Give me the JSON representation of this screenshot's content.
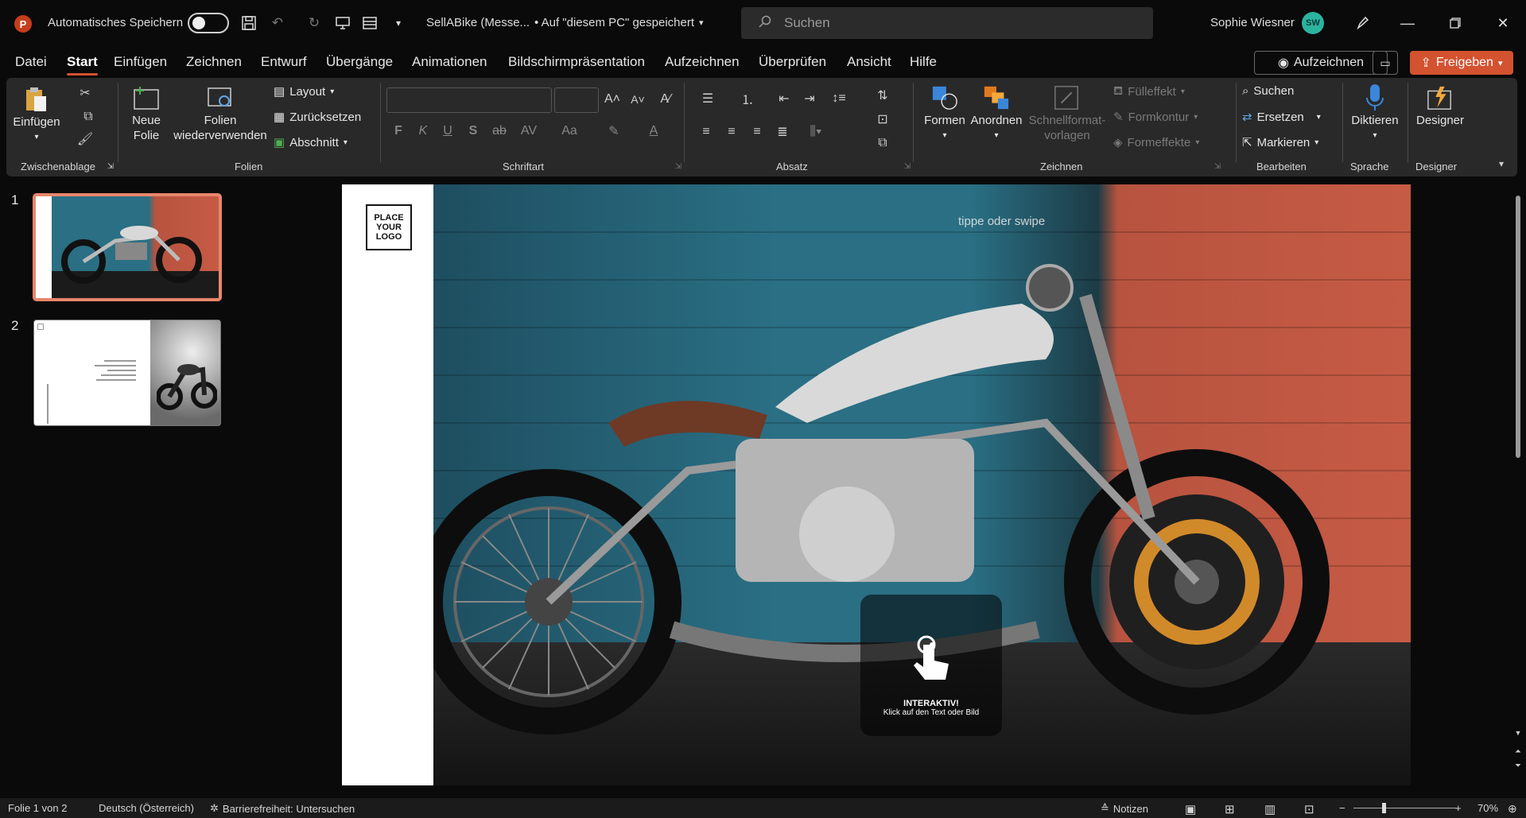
{
  "titlebar": {
    "autosave_label": "Automatisches Speichern",
    "doc_title": "SellABike (Messe...",
    "save_state": "• Auf \"diesem PC\" gespeichert",
    "search_placeholder": "Suchen",
    "user_name": "Sophie Wiesner",
    "user_initials": "SW"
  },
  "menu": {
    "tabs": [
      "Datei",
      "Start",
      "Einfügen",
      "Zeichnen",
      "Entwurf",
      "Übergänge",
      "Animationen",
      "Bildschirmpräsentation",
      "Aufzeichnen",
      "Überprüfen",
      "Ansicht",
      "Hilfe"
    ],
    "active_tab": "Start",
    "record_label": "Aufzeichnen",
    "share_label": "Freigeben"
  },
  "ribbon": {
    "clipboard": {
      "paste": "Einfügen",
      "label": "Zwischenablage"
    },
    "slides": {
      "new_slide_1": "Neue",
      "new_slide_2": "Folie",
      "reuse_1": "Folien",
      "reuse_2": "wiederverwenden",
      "layout": "Layout",
      "reset": "Zurücksetzen",
      "section": "Abschnitt",
      "label": "Folien"
    },
    "font": {
      "label": "Schriftart",
      "bold": "F",
      "italic": "K",
      "underline": "U",
      "shadow": "S",
      "strike": "ab",
      "case": "Aa"
    },
    "paragraph": {
      "label": "Absatz"
    },
    "drawing": {
      "shapes": "Formen",
      "arrange": "Anordnen",
      "quick_styles_1": "Schnellformat-",
      "quick_styles_2": "vorlagen",
      "fill": "Fülleffekt",
      "outline": "Formkontur",
      "effects": "Formeffekte",
      "label": "Zeichnen"
    },
    "editing": {
      "find": "Suchen",
      "replace": "Ersetzen",
      "select": "Markieren",
      "label": "Bearbeiten"
    },
    "voice": {
      "dictate": "Diktieren",
      "label": "Sprache"
    },
    "designer": {
      "button": "Designer",
      "label": "Designer"
    }
  },
  "thumbnails": [
    {
      "number": "1"
    },
    {
      "number": "2"
    }
  ],
  "slide": {
    "logo_line1": "PLACE",
    "logo_line2": "YOUR",
    "logo_line3": "LOGO",
    "hint": "tippe oder swipe",
    "interaction_title": "INTERAKTIV!",
    "interaction_sub": "Klick auf den Text oder Bild"
  },
  "status": {
    "slide_count": "Folie 1 von 2",
    "language": "Deutsch (Österreich)",
    "accessibility": "Barrierefreiheit: Untersuchen",
    "notes": "Notizen",
    "zoom": "70%"
  },
  "colors": {
    "accent": "#d35230",
    "selection": "#e8866b",
    "ribbon": "#292929"
  }
}
